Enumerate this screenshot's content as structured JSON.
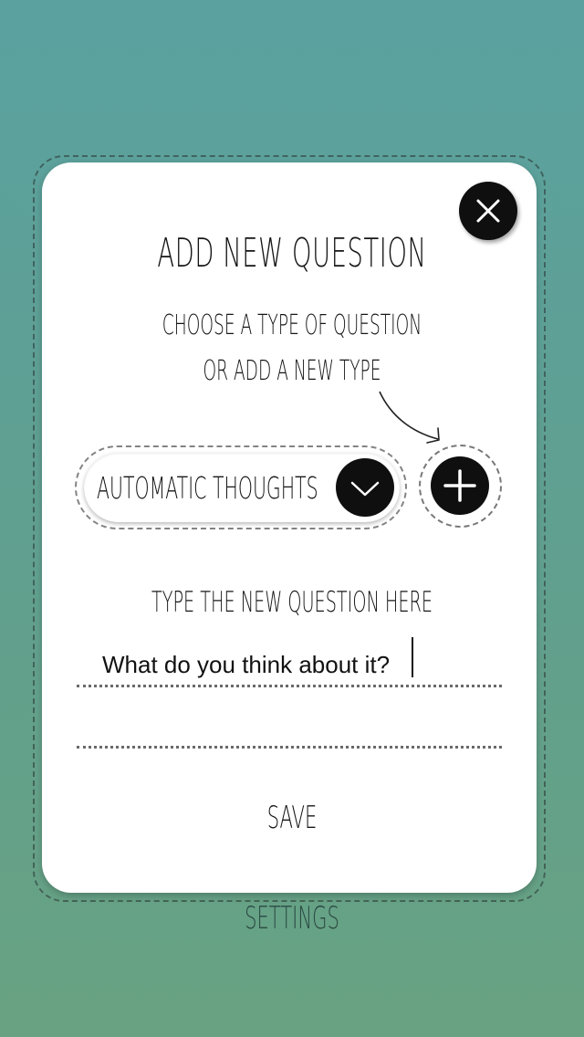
{
  "dialog": {
    "title": "Add New Question",
    "subtitle_line1": "Choose a type of question",
    "subtitle_line2": "or add a new type",
    "close_icon": "close-icon",
    "type_select": {
      "selected": "Automatic Thoughts",
      "icon": "chevron-down-icon"
    },
    "add_type_icon": "plus-icon",
    "question_prompt": "Type the new question here",
    "question_input": {
      "value": "What do you think about it?"
    },
    "save_label": "Save"
  },
  "footer": {
    "settings_label": "Settings"
  },
  "colors": {
    "background_top": "#5aa1a0",
    "background_bottom": "#68a282",
    "card": "#ffffff",
    "button": "#0f0f0f",
    "settings_text": "#2b4a44"
  }
}
